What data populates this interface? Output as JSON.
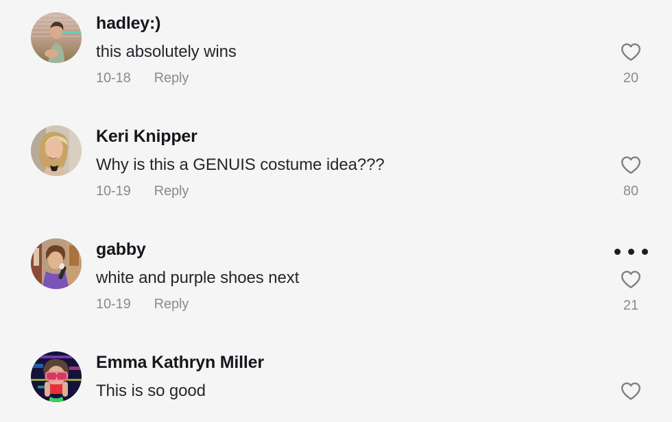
{
  "page": {
    "background_color": "#f5f5f5",
    "username_color": "#17161c",
    "comment_color": "#26252c",
    "muted_color": "#8a8a8f",
    "dots_color": "#1d1c26"
  },
  "labels": {
    "reply": "Reply",
    "heart_icon": "heart-outline-icon",
    "more_icon": "more-options-icon"
  },
  "comments": [
    {
      "username": "hadley:)",
      "text": "this absolutely wins",
      "date": "10-18",
      "reply": "Reply",
      "likes": "20",
      "has_more_menu": false,
      "has_meta": true,
      "avatar_name": "avatar-hadley"
    },
    {
      "username": "Keri Knipper",
      "text": "Why is this a GENUIS costume idea???",
      "date": "10-19",
      "reply": "Reply",
      "likes": "80",
      "has_more_menu": false,
      "has_meta": true,
      "avatar_name": "avatar-keri-knipper"
    },
    {
      "username": "gabby",
      "text": "white and purple shoes next",
      "date": "10-19",
      "reply": "Reply",
      "likes": "21",
      "has_more_menu": true,
      "has_meta": true,
      "avatar_name": "avatar-gabby"
    },
    {
      "username": "Emma Kathryn Miller",
      "text": "This is so good",
      "date": "",
      "reply": "",
      "likes": "",
      "has_more_menu": false,
      "has_meta": false,
      "avatar_name": "avatar-emma-kathryn-miller"
    }
  ]
}
